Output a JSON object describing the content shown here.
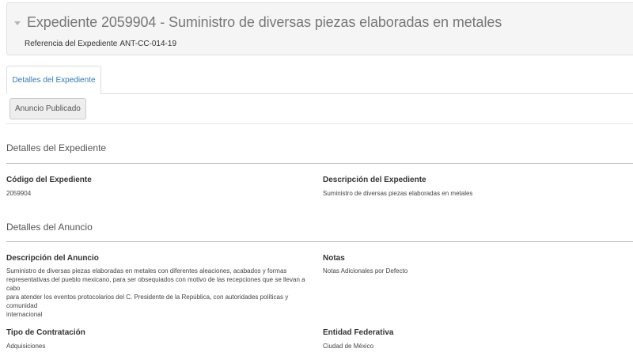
{
  "header": {
    "title": "Expediente 2059904 - Suministro de diversas piezas elaboradas en metales",
    "reference_label": "Referencia del Expediente",
    "reference_value": "ANT-CC-014-19"
  },
  "tabs": [
    {
      "label": "Detalles del Expediente",
      "active": true
    }
  ],
  "sub_tabs": [
    {
      "label": "Anuncio Publicado"
    }
  ],
  "sections": {
    "expediente": {
      "title": "Detalles del Expediente",
      "codigo_label": "Código del Expediente",
      "codigo_value": "2059904",
      "descripcion_label": "Descripción del Expediente",
      "descripcion_value": "Suministro de diversas piezas elaboradas en metales"
    },
    "anuncio": {
      "title": "Detalles del Anuncio",
      "descripcion_label": "Descripción del Anuncio",
      "descripcion_lines": [
        "Suministro de diversas piezas elaboradas en metales con diferentes aleaciones, acabados y formas",
        "representativas del pueblo mexicano, para ser obsequiados con motivo de las recepciones que se llevan a cabo",
        "para atender los eventos protocolarios del C. Presidente de la República, con autoridades políticas y comunidad",
        "internacional"
      ],
      "notas_label": "Notas",
      "notas_value": "Notas Adicionales por Defecto",
      "tipo_label": "Tipo de Contratación",
      "tipo_value": "Adquisiciones",
      "entidad_label": "Entidad Federativa",
      "entidad_value": "Ciudad de México"
    }
  }
}
